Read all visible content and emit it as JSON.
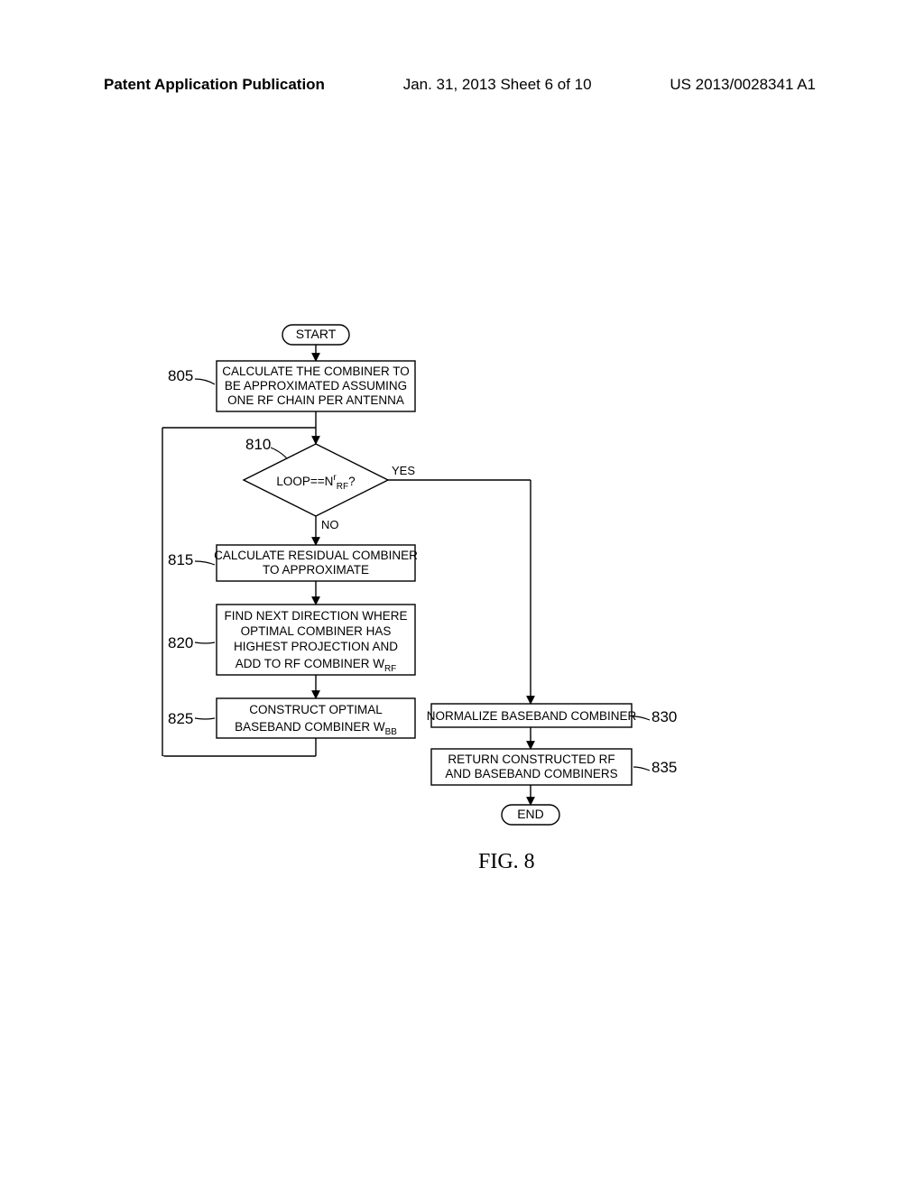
{
  "header": {
    "pub": "Patent Application Publication",
    "sheet": "Jan. 31, 2013  Sheet 6 of 10",
    "num": "US 2013/0028341 A1"
  },
  "flow": {
    "start": "START",
    "end": "END",
    "b805_l1": "CALCULATE THE COMBINER TO",
    "b805_l2": "BE APPROXIMATED ASSUMING",
    "b805_l3": "ONE RF CHAIN PER ANTENNA",
    "b810_pre": "LOOP==N",
    "b810_sup": "r",
    "b810_sub": "RF",
    "b810_q": "?",
    "yes": "YES",
    "no": "NO",
    "b815_l1": "CALCULATE RESIDUAL COMBINER",
    "b815_l2": "TO APPROXIMATE",
    "b820_l1": "FIND NEXT DIRECTION WHERE",
    "b820_l2": "OPTIMAL COMBINER HAS",
    "b820_l3": "HIGHEST PROJECTION AND",
    "b820_l4_pre": "ADD TO RF COMBINER W",
    "b820_l4_sub": "RF",
    "b825_l1": "CONSTRUCT OPTIMAL",
    "b825_l2_pre": "BASEBAND COMBINER W",
    "b825_l2_sub": "BB",
    "b830": "NORMALIZE BASEBAND COMBINER",
    "b835_l1": "RETURN CONSTRUCTED RF",
    "b835_l2": "AND BASEBAND COMBINERS"
  },
  "refs": {
    "r805": "805",
    "r810": "810",
    "r815": "815",
    "r820": "820",
    "r825": "825",
    "r830": "830",
    "r835": "835"
  },
  "figure": "FIG. 8"
}
